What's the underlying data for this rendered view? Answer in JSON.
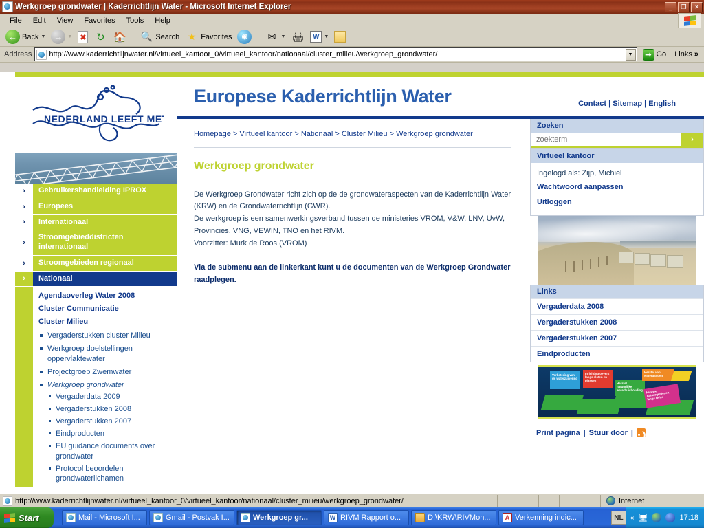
{
  "browser": {
    "window_title": "Werkgroep grondwater | Kaderrichtlijn Water - Microsoft Internet Explorer",
    "minimize": "_",
    "maximize": "❐",
    "close": "✕",
    "menus": [
      "File",
      "Edit",
      "View",
      "Favorites",
      "Tools",
      "Help"
    ],
    "toolbar": {
      "back": "Back",
      "forward": "",
      "stop": "",
      "refresh": "",
      "home": "",
      "search": "Search",
      "favorites": "Favorites",
      "media": "",
      "mail": "",
      "print": "",
      "edit_word": "W",
      "messenger": ""
    },
    "address": {
      "label": "Address",
      "url": "http://www.kaderrichtlijnwater.nl/virtueel_kantoor_0/virtueel_kantoor/nationaal/cluster_milieu/werkgroep_grondwater/",
      "go_label": "Go",
      "links_label": "Links",
      "links_chevron": "»"
    },
    "statusbar": {
      "url": "http://www.kaderrichtlijnwater.nl/virtueel_kantoor_0/virtueel_kantoor/nationaal/cluster_milieu/werkgroep_grondwater/",
      "zone": "Internet"
    }
  },
  "taskbar": {
    "start": "Start",
    "tasks": [
      {
        "label": "Mail - Microsoft I...",
        "icon": "ie-icon",
        "active": false
      },
      {
        "label": "Gmail - Postvak I...",
        "icon": "ie-icon",
        "active": false
      },
      {
        "label": "Werkgroep gr...",
        "icon": "ie-icon",
        "active": true
      },
      {
        "label": "RIVM Rapport o...",
        "icon": "word-icon",
        "active": false
      },
      {
        "label": "D:\\KRW\\RIVMon...",
        "icon": "folder-icon",
        "active": false
      },
      {
        "label": "Verkenning indic...",
        "icon": "pdf-icon",
        "active": false
      }
    ],
    "language": "NL",
    "clock": "17:18",
    "tray_chevron": "«"
  },
  "site": {
    "logo_alt": "NEDERLAND LEEFT MET WATER",
    "title": "Europese Kaderrichtlijn Water",
    "header_links": [
      {
        "label": "Contact"
      },
      {
        "label": "Sitemap"
      },
      {
        "label": "English"
      }
    ],
    "header_sep": "|"
  },
  "left_nav": {
    "arrow_glyph": "›",
    "items": [
      {
        "label": "Gebruikershandleiding IPROX",
        "active": false
      },
      {
        "label": "Europees",
        "active": false
      },
      {
        "label": "Internationaal",
        "active": false
      },
      {
        "label": "Stroomgebieddistricten internationaal",
        "active": false
      },
      {
        "label": "Stroomgebieden regionaal",
        "active": false
      },
      {
        "label": "Nationaal",
        "active": true
      }
    ],
    "sub_sections": [
      {
        "title": "Agendaoverleg Water 2008",
        "items": []
      },
      {
        "title": "Cluster Communicatie",
        "items": []
      },
      {
        "title": "Cluster Milieu",
        "items": [
          {
            "label": "Vergaderstukken cluster Milieu",
            "current": false,
            "children": []
          },
          {
            "label": "Werkgroep doelstellingen oppervlaktewater",
            "current": false,
            "children": []
          },
          {
            "label": "Projectgroep Zwemwater",
            "current": false,
            "children": []
          },
          {
            "label": "Werkgroep grondwater",
            "current": true,
            "children": [
              "Vergaderdata 2009",
              "Vergaderstukken 2008",
              "Vergaderstukken 2007",
              "Eindproducten",
              "EU guidance documents over grondwater",
              "Protocol beoordelen grondwaterlichamen"
            ]
          }
        ]
      }
    ]
  },
  "main": {
    "breadcrumb": {
      "separator": ">",
      "items": [
        {
          "label": "Homepage",
          "link": true
        },
        {
          "label": "Virtueel kantoor",
          "link": true
        },
        {
          "label": "Nationaal",
          "link": true
        },
        {
          "label": "Cluster Milieu",
          "link": true
        },
        {
          "label": "Werkgroep grondwater",
          "link": false
        }
      ]
    },
    "heading": "Werkgroep grondwater",
    "paragraphs": [
      "De Werkgroep Grondwater richt zich op de de grondwateraspecten van de Kaderrichtlijn Water (KRW) en de Grondwaterrichtlijn (GWR).",
      "De werkgroep is een samenwerkingsverband tussen de ministeries VROM, V&W, LNV, UvW, Provincies, VNG, VEWIN, TNO en het RIVM.",
      "Voorzitter: Murk de Roos (VROM)"
    ],
    "bold_note": "Via de submenu aan de linkerkant kunt u de documenten van de Werkgroep Grondwater raadplegen."
  },
  "right_col": {
    "search": {
      "heading": "Zoeken",
      "placeholder": "zoekterm",
      "value": "",
      "button": "›"
    },
    "office": {
      "heading": "Virtueel kantoor",
      "logged_in_as": "Ingelogd als: Zijp, Michiel",
      "links": [
        "Wachtwoord aanpassen",
        "Uitloggen"
      ]
    },
    "beach_photo_alt": "Strand met strandhuisjes",
    "links": {
      "heading": "Links",
      "items": [
        "Vergaderdata 2008",
        "Vergaderstukken 2008",
        "Vergaderstukken 2007",
        "Eindproducten"
      ]
    },
    "promo": {
      "alt": "Kleurige bordjes met maatregelen",
      "flags": [
        "Verbetering van de waterzuivering",
        "Inrichting oevers langs sloten en plassen",
        "Herstel natuurlijke waterhuishouding",
        "Nieuwe natuurgebieden langs rivier",
        "Herstel van watergangen"
      ]
    },
    "footer": {
      "print": "Print pagina",
      "separator": "|",
      "send": "Stuur door",
      "rss_alt": "RSS feed"
    }
  },
  "colors": {
    "brand_green": "#bed230",
    "brand_navy": "#123a8c",
    "title_blue": "#2b5fae",
    "panel_head": "#c7d5e8",
    "body_text": "#1b3a5c"
  }
}
